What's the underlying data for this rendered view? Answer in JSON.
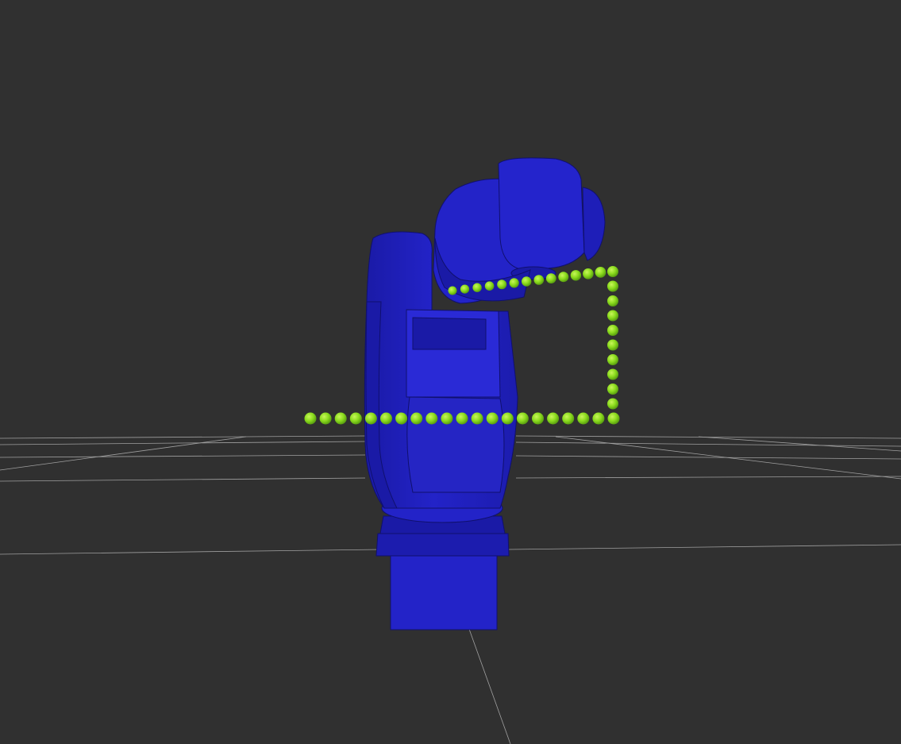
{
  "viewport": {
    "background_color": "#303030",
    "grid_color": "#b4b4b4"
  },
  "robot": {
    "color": "#2323c8",
    "shade_color": "#1a1aa6",
    "highlight_color": "#3232e0",
    "outline_color": "#10106e"
  },
  "trajectory": {
    "marker_color": "#8cdc1e",
    "marker_highlight": "#c8f55a",
    "marker_shade": "#5aa010"
  }
}
